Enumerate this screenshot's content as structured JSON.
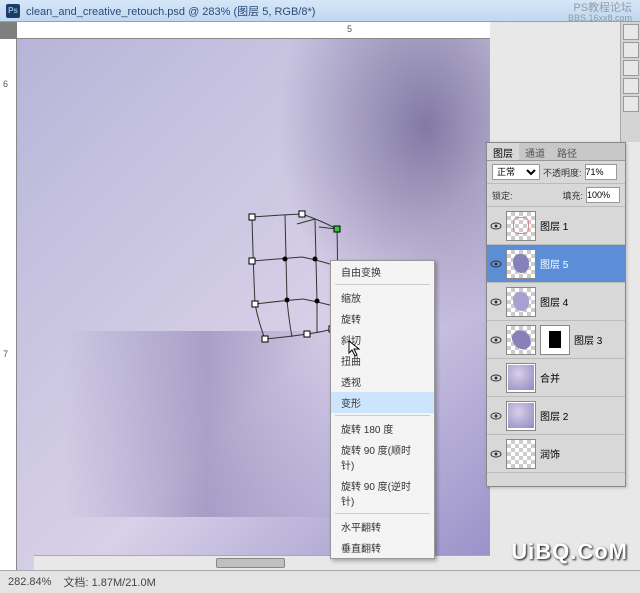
{
  "titlebar": {
    "filename": "clean_and_creative_retouch.psd",
    "zoom": "@ 283%",
    "layer_info": "(图层 5, RGB/8*)"
  },
  "watermark": {
    "top": "PS教程论坛",
    "top_sub": "BBS.16xx8.com",
    "bottom": "UiBQ.CoM"
  },
  "context_menu": {
    "items": [
      {
        "label": "自由变换",
        "section": 0
      },
      {
        "label": "缩放",
        "section": 1
      },
      {
        "label": "旋转",
        "section": 1
      },
      {
        "label": "斜切",
        "section": 1
      },
      {
        "label": "扭曲",
        "section": 1
      },
      {
        "label": "透视",
        "section": 1
      },
      {
        "label": "变形",
        "section": 1,
        "selected": true
      },
      {
        "label": "旋转 180 度",
        "section": 2
      },
      {
        "label": "旋转 90 度(顺时针)",
        "section": 2
      },
      {
        "label": "旋转 90 度(逆时针)",
        "section": 2
      },
      {
        "label": "水平翻转",
        "section": 3
      },
      {
        "label": "垂直翻转",
        "section": 3
      }
    ]
  },
  "layers_panel": {
    "tabs": [
      "图层",
      "通道",
      "路径"
    ],
    "active_tab": 0,
    "blend_mode": "正常",
    "opacity_label": "不透明度:",
    "opacity_value": "71%",
    "lock_label": "锁定:",
    "fill_label": "填充:",
    "fill_value": "100%",
    "layers": [
      {
        "name": "图层 1",
        "visible": true,
        "thumb": "checker-pink"
      },
      {
        "name": "图层 5",
        "visible": true,
        "selected": true,
        "thumb": "checker-blob"
      },
      {
        "name": "图层 4",
        "visible": true,
        "thumb": "checker-blob2"
      },
      {
        "name": "图层 3",
        "visible": true,
        "thumb": "checker-mask"
      },
      {
        "name": "合并",
        "visible": true,
        "thumb": "face"
      },
      {
        "name": "图层 2",
        "visible": true,
        "thumb": "face2"
      },
      {
        "name": "润饰",
        "visible": true,
        "thumb": "checker"
      }
    ]
  },
  "ruler": {
    "h_marks": [
      "5"
    ],
    "v_marks": [
      "6",
      "7"
    ]
  },
  "statusbar": {
    "zoom": "282.84%",
    "doc_label": "文档:",
    "doc_size": "1.87M/21.0M"
  }
}
